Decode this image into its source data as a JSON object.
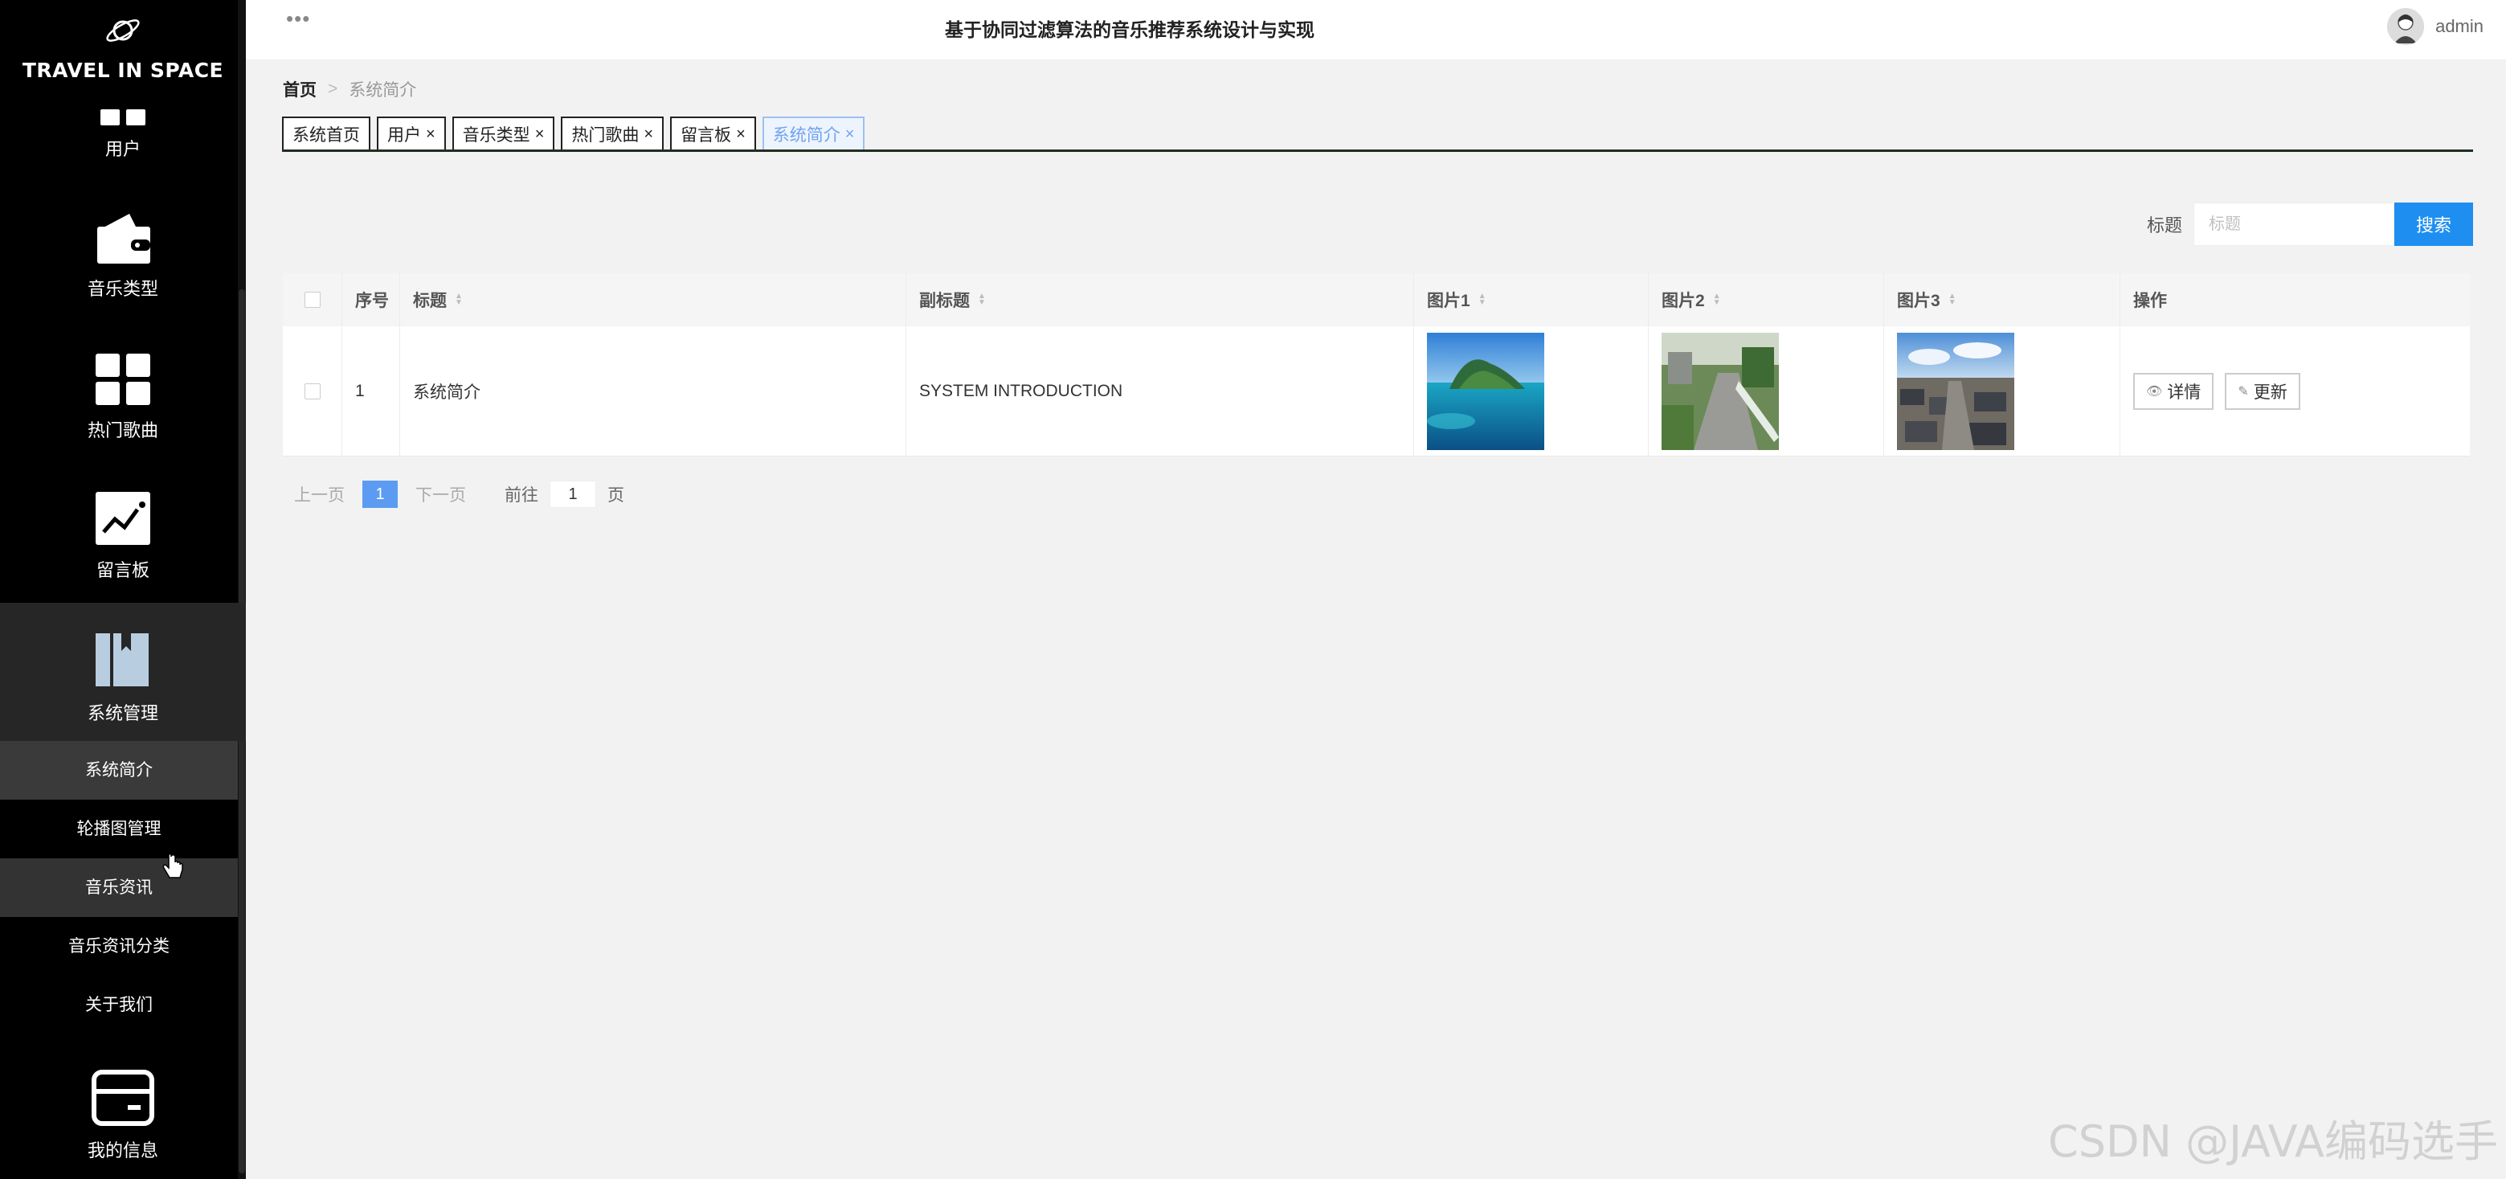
{
  "sidebar": {
    "logo_text": "TRAVEL IN SPACE",
    "items": [
      {
        "label": "用户",
        "icon": "users-icon"
      },
      {
        "label": "音乐类型",
        "icon": "wallet-icon"
      },
      {
        "label": "热门歌曲",
        "icon": "grid-icon"
      },
      {
        "label": "留言板",
        "icon": "chart-icon"
      },
      {
        "label": "系统管理",
        "icon": "book-icon"
      }
    ],
    "sub_items": [
      "系统简介",
      "轮播图管理",
      "音乐资讯",
      "音乐资讯分类",
      "关于我们"
    ],
    "bottom_item": {
      "label": "我的信息",
      "icon": "card-icon"
    }
  },
  "header": {
    "title": "基于协同过滤算法的音乐推荐系统设计与实现",
    "username": "admin"
  },
  "breadcrumb": {
    "home": "首页",
    "separator": ">",
    "current": "系统简介"
  },
  "tabs": [
    {
      "label": "系统首页",
      "closable": false
    },
    {
      "label": "用户",
      "closable": true
    },
    {
      "label": "音乐类型",
      "closable": true
    },
    {
      "label": "热门歌曲",
      "closable": true
    },
    {
      "label": "留言板",
      "closable": true
    },
    {
      "label": "系统简介",
      "closable": true
    }
  ],
  "close_glyph": "×",
  "search": {
    "label": "标题",
    "placeholder": "标题",
    "button": "搜索"
  },
  "table": {
    "columns": [
      "序号",
      "标题",
      "副标题",
      "图片1",
      "图片2",
      "图片3",
      "操作"
    ],
    "rows": [
      {
        "no": "1",
        "title": "系统简介",
        "subtitle": "SYSTEM INTRODUCTION"
      }
    ],
    "actions": {
      "detail": "详情",
      "update": "更新"
    }
  },
  "pagination": {
    "prev": "上一页",
    "current": "1",
    "next": "下一页",
    "goto": "前往",
    "page_value": "1",
    "unit": "页"
  },
  "watermark": "CSDN @JAVA编码选手",
  "colors": {
    "sidebar_bg": "#000000",
    "primary": "#1e8ff0",
    "active_tab": "#6fa3ef"
  }
}
